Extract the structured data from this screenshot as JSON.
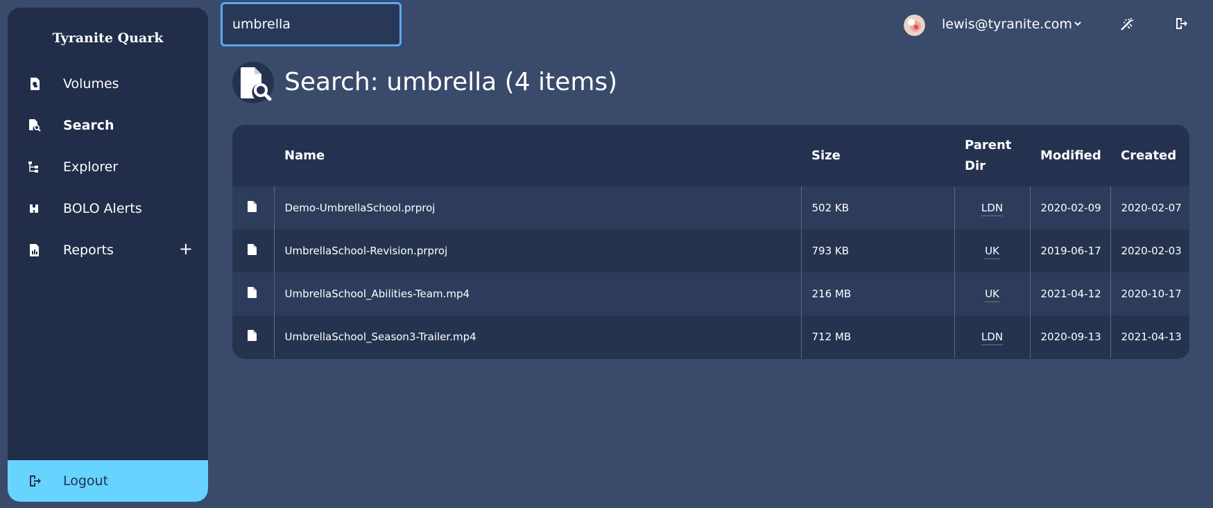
{
  "app": {
    "title": "Tyranite Quark"
  },
  "sidebar": {
    "items": [
      {
        "label": "Volumes",
        "icon": "sd-card-icon",
        "active": false
      },
      {
        "label": "Search",
        "icon": "file-search-icon",
        "active": true
      },
      {
        "label": "Explorer",
        "icon": "tree-icon",
        "active": false
      },
      {
        "label": "BOLO Alerts",
        "icon": "binoculars-icon",
        "active": false
      },
      {
        "label": "Reports",
        "icon": "report-icon",
        "active": false,
        "expand": "+"
      }
    ],
    "logout_label": "Logout"
  },
  "search": {
    "value": "umbrella"
  },
  "user": {
    "email": "lewis@tyranite.com"
  },
  "page": {
    "title": "Search: umbrella (4 items)"
  },
  "table": {
    "headers": {
      "name": "Name",
      "size": "Size",
      "parent_dir": "Parent Dir",
      "modified": "Modified",
      "created": "Created"
    },
    "rows": [
      {
        "name": "Demo-UmbrellaSchool.prproj",
        "size": "502 KB",
        "parent_dir": "LDN",
        "modified": "2020-02-09",
        "created": "2020-02-07"
      },
      {
        "name": "UmbrellaSchool-Revision.prproj",
        "size": "793 KB",
        "parent_dir": "UK",
        "modified": "2019-06-17",
        "created": "2020-02-03"
      },
      {
        "name": "UmbrellaSchool_Abilities-Team.mp4",
        "size": "216 MB",
        "parent_dir": "UK",
        "modified": "2021-04-12",
        "created": "2020-10-17"
      },
      {
        "name": "UmbrellaSchool_Season3-Trailer.mp4",
        "size": "712 MB",
        "parent_dir": "LDN",
        "modified": "2020-09-13",
        "created": "2021-04-13"
      }
    ]
  },
  "colors": {
    "background": "#3a4a6a",
    "sidebar": "#212d49",
    "accent": "#66d4ff",
    "focus": "#5aa9ff"
  }
}
